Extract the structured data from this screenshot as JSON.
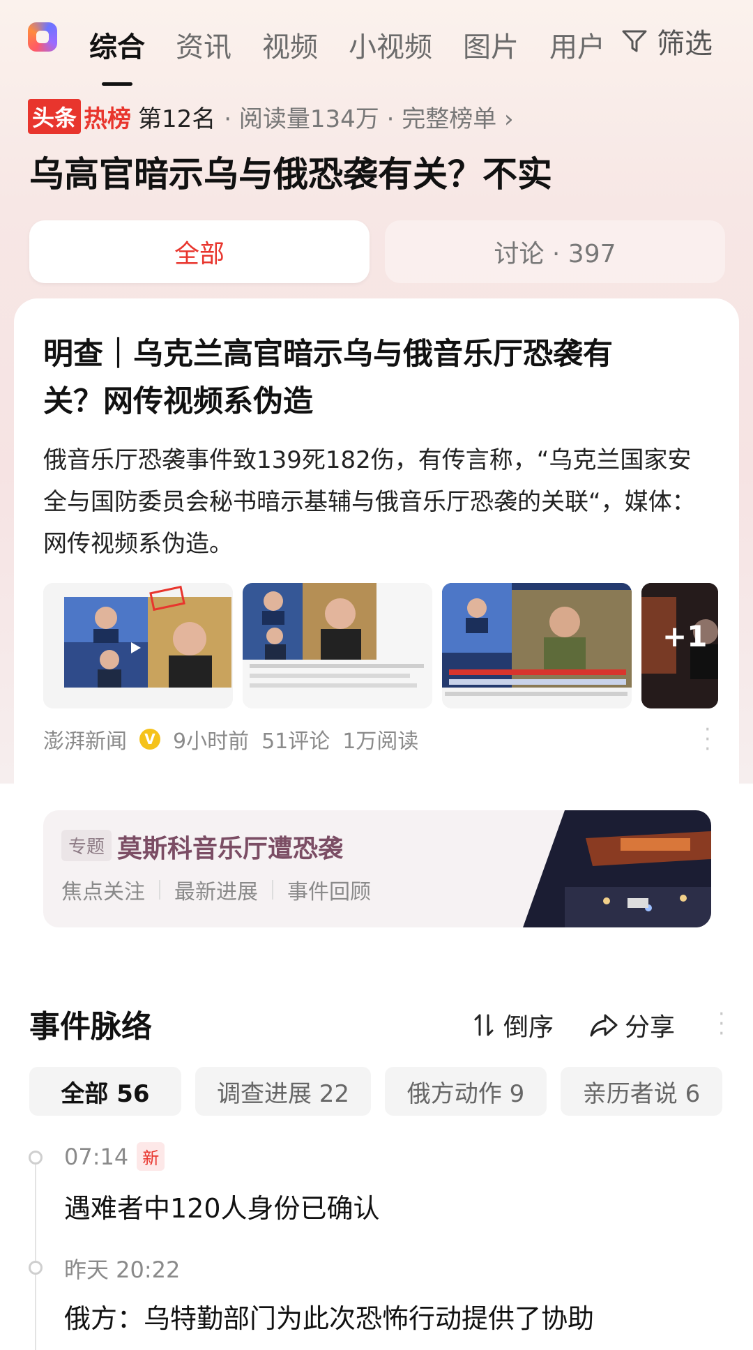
{
  "top_nav": {
    "tabs": [
      "综合",
      "资讯",
      "视频",
      "小视频",
      "图片",
      "用户"
    ],
    "filter_label": "筛选"
  },
  "hot": {
    "badge_part1": "头条",
    "badge_part2": "热榜",
    "rank": "第12名",
    "meta": "· 阅读量134万 · 完整榜单 ›"
  },
  "main_title": "乌高官暗示乌与俄恐袭有关？不实",
  "segment": {
    "all_label": "全部",
    "discuss_label": "讨论 · 397"
  },
  "article": {
    "title": "明查｜乌克兰高官暗示乌与俄音乐厅恐袭有关？网传视频系伪造",
    "body": "俄音乐厅恐袭事件致139死182伤，有传言称，“乌克兰国家安全与国防委员会秘书暗示基辅与俄音乐厅恐袭的关联“，媒体：网传视频系伪造。",
    "more_images": "+1",
    "source": "澎湃新闻",
    "time": "9小时前",
    "comments": "51评论",
    "reads": "1万阅读"
  },
  "topic": {
    "tag": "专题",
    "title": "莫斯科音乐厅遭恐袭",
    "links": [
      "焦点关注",
      "最新进展",
      "事件回顾"
    ]
  },
  "timeline": {
    "title": "事件脉络",
    "sort_label": "倒序",
    "share_label": "分享",
    "chips": [
      {
        "label": "全部 56"
      },
      {
        "label": "调查进展 22"
      },
      {
        "label": "俄方动作 9"
      },
      {
        "label": "亲历者说 6"
      }
    ],
    "items": [
      {
        "time": "07:14",
        "badge": "新",
        "text": "遇难者中120人身份已确认"
      },
      {
        "time": "昨天 20:22",
        "text": "俄方：乌特勤部门为此次恐怖行动提供了协助"
      }
    ]
  },
  "colors": {
    "accent_red": "#e8352d",
    "topic_purple": "#7b4d64",
    "verified_yellow": "#f5c21b"
  }
}
